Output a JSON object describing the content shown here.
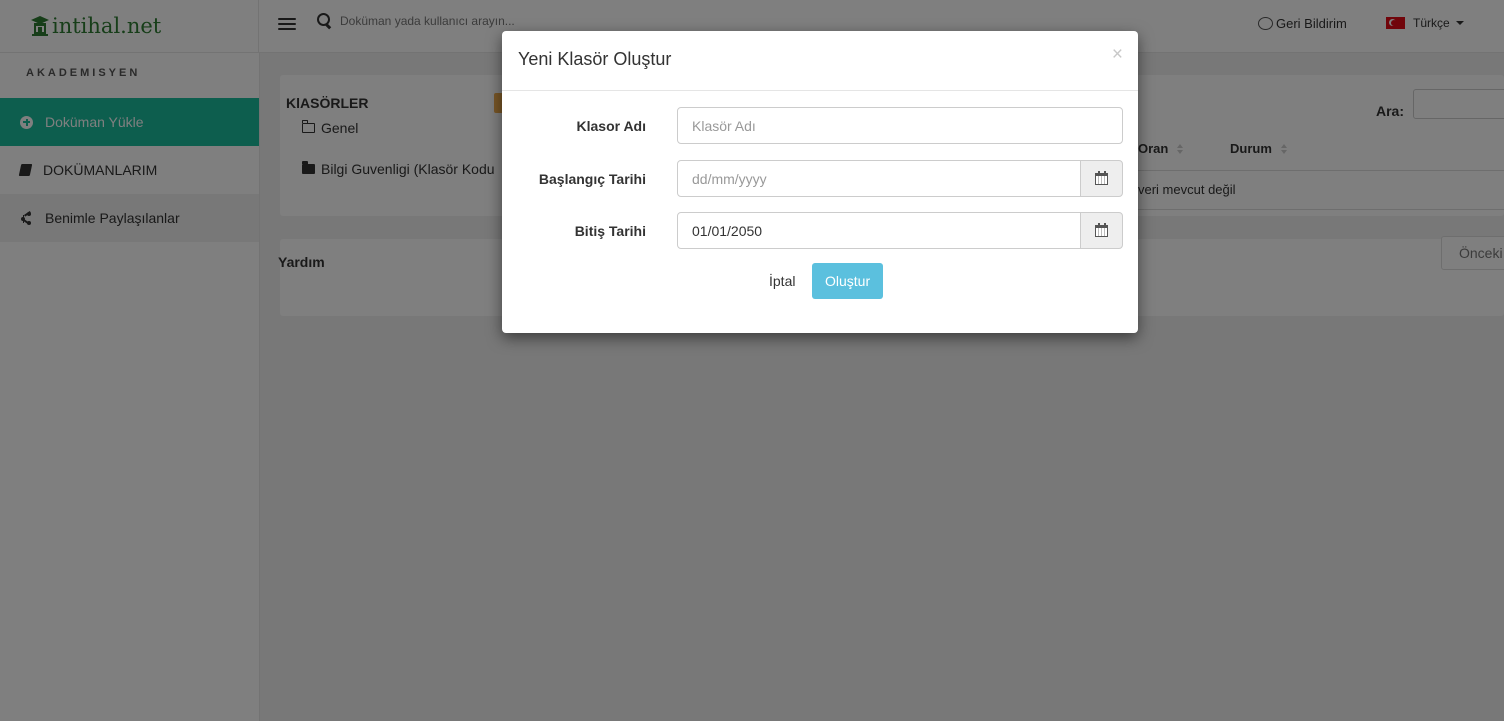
{
  "brand": {
    "name": "intihal.net"
  },
  "header": {
    "search_placeholder": "Doküman yada kullanıcı arayın...",
    "feedback_label": "Geri Bildirim",
    "language_label": "Türkçe"
  },
  "sidebar": {
    "heading": "AKADEMISYEN",
    "items": [
      {
        "label": "Doküman Yükle",
        "icon": "plus-circle-icon",
        "active": true
      },
      {
        "label": "DOKÜMANLARIM",
        "icon": "book-icon"
      },
      {
        "label": "Benimle Paylaşılanlar",
        "icon": "share-icon"
      }
    ]
  },
  "folders": {
    "title": "KlASÖRLER",
    "items": [
      {
        "label": "Genel",
        "icon": "folder-open-icon"
      },
      {
        "label": "Bilgi Guvenligi (Klasör Kodu",
        "icon": "folder-icon"
      }
    ]
  },
  "help": {
    "title": "Yardım"
  },
  "table": {
    "search_label": "Ara:",
    "columns": [
      "Oran",
      "Durum"
    ],
    "empty_message": "Tabloda herhangi bir veri mevcut değil",
    "visible_empty_fragment": "veri mevcut değil",
    "prev_label": "Önceki"
  },
  "modal": {
    "title": "Yeni Klasör Oluştur",
    "close_symbol": "×",
    "fields": {
      "name": {
        "label": "Klasor Adı",
        "placeholder": "Klasör Adı",
        "value": ""
      },
      "start": {
        "label": "Başlangıç Tarihi",
        "placeholder": "dd/mm/yyyy",
        "value": ""
      },
      "end": {
        "label": "Bitiş Tarihi",
        "placeholder": "dd/mm/yyyy",
        "value": "01/01/2050"
      }
    },
    "cancel_label": "İptal",
    "create_label": "Oluştur"
  },
  "colors": {
    "sidebar_active": "#1abc9c",
    "primary_button": "#5bc0de",
    "brand_green": "#2e7d32",
    "folder_badge": "#f0ad4e"
  }
}
